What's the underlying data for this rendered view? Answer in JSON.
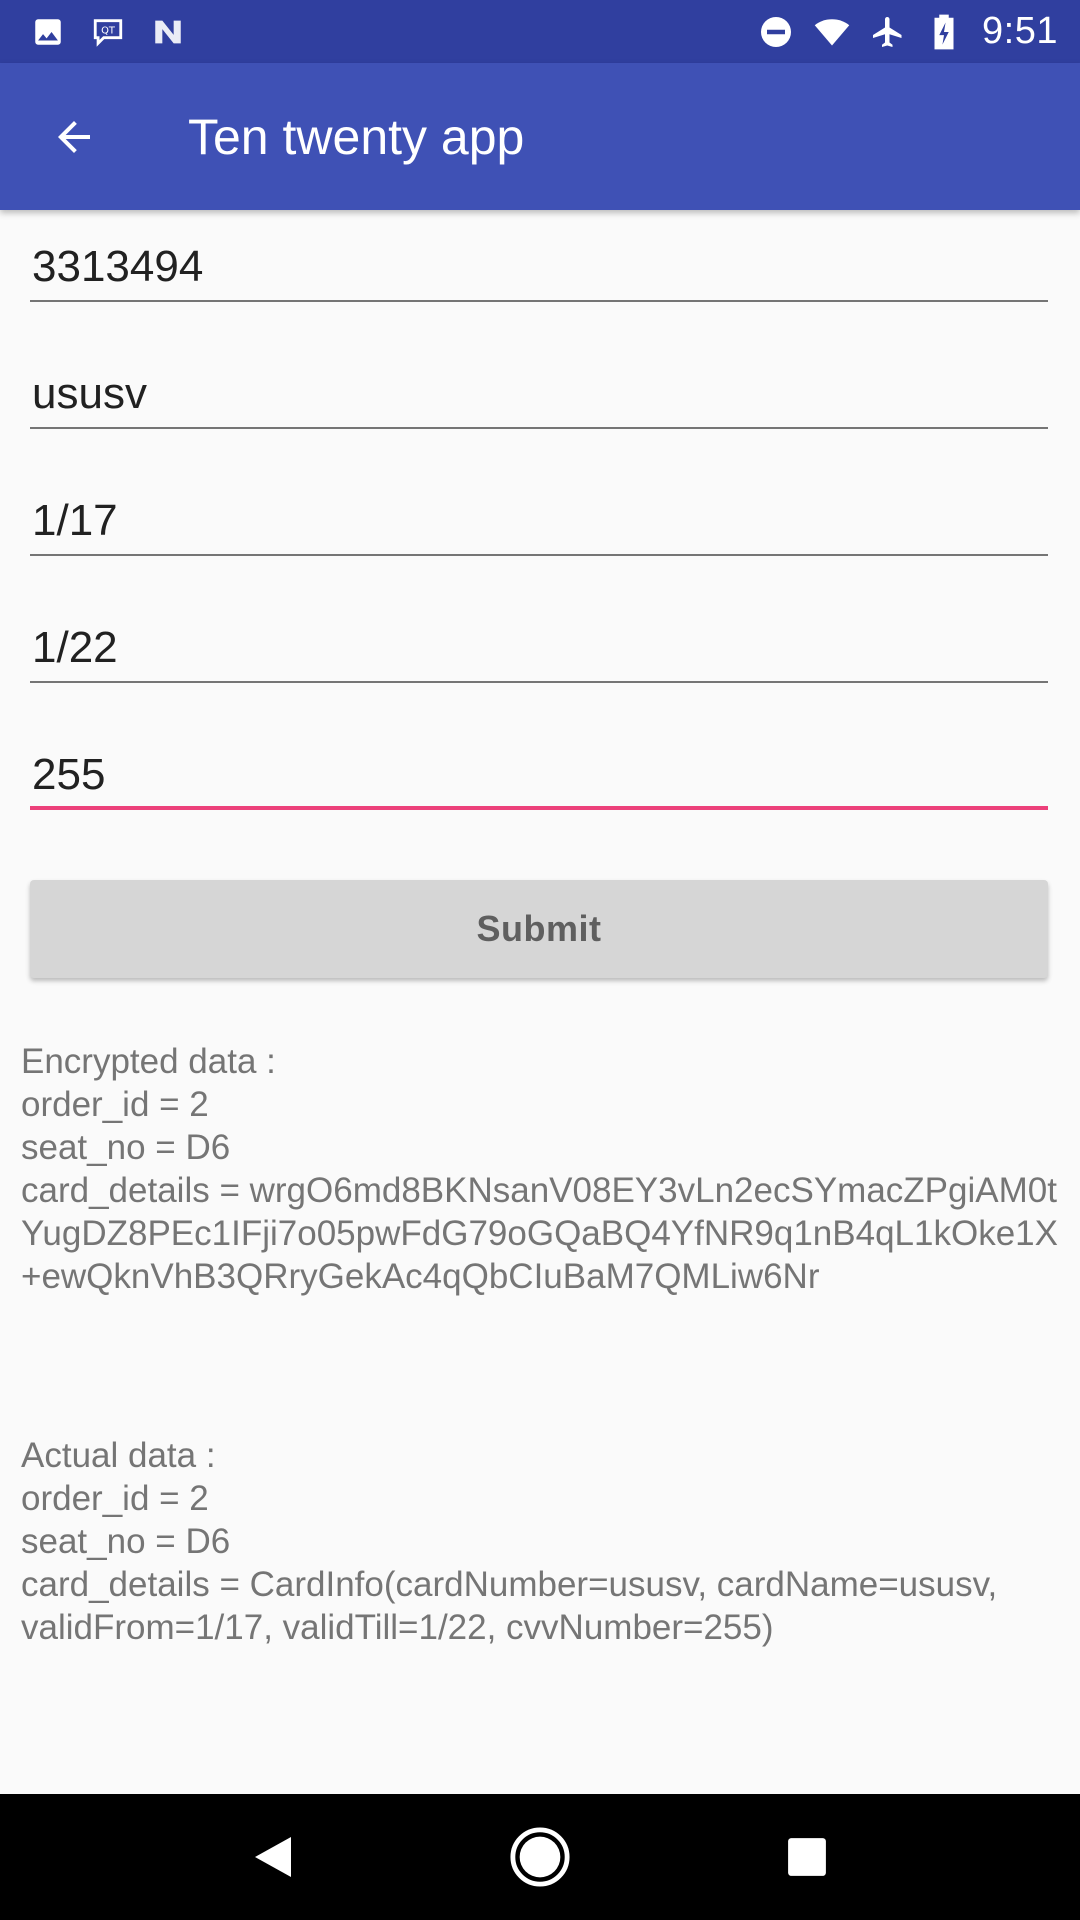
{
  "status_bar": {
    "time": "9:51",
    "left_icons": [
      "image-icon",
      "qt-icon",
      "n-icon"
    ],
    "right_icons": [
      "dnd-icon",
      "wifi-icon",
      "airplane-icon",
      "battery-charging-icon"
    ]
  },
  "app_bar": {
    "title": "Ten twenty app",
    "back_icon": "arrow-back-icon"
  },
  "form": {
    "fields": [
      {
        "value": "3313494"
      },
      {
        "value": "ususv"
      },
      {
        "value": "1/17"
      },
      {
        "value": "1/22"
      },
      {
        "value": "255"
      }
    ],
    "submit_label": "Submit"
  },
  "encrypted": {
    "header": "Encrypted data :",
    "order_id": "order_id = 2",
    "seat_no": "seat_no = D6",
    "card_details": "card_details = wrgO6md8BKNsanV08EY3vLn2ecSYmacZPgiAM0tYugDZ8PEc1IFji7o05pwFdG79oGQaBQ4YfNR9q1nB4qL1kOke1X+ewQknVhB3QRryGekAc4qQbCIuBaM7QMLiw6Nr"
  },
  "actual": {
    "header": "Actual data :",
    "order_id": "order_id = 2",
    "seat_no": "seat_no = D6",
    "card_details": "card_details = CardInfo(cardNumber=ususv, cardName=ususv, validFrom=1/17, validTill=1/22, cvvNumber=255)"
  },
  "nav_bar": {
    "buttons": [
      "back-triangle-icon",
      "home-circle-icon",
      "recents-square-icon"
    ]
  },
  "colors": {
    "status_bar": "#303f9f",
    "app_bar": "#3f51b5",
    "accent": "#ec407a",
    "button": "#d6d6d6"
  }
}
